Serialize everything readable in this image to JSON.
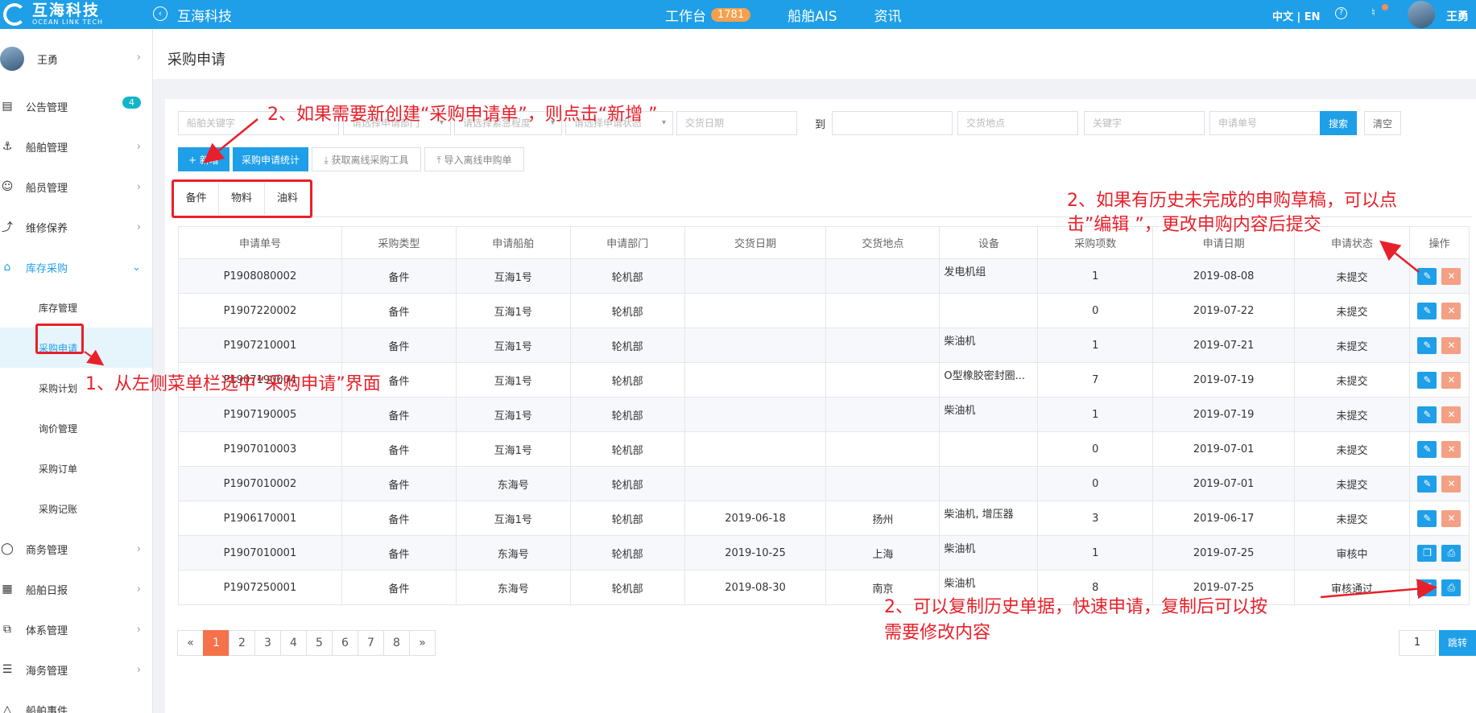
{
  "header": {
    "logo_cn": "互海科技",
    "logo_en": "OCEAN LINK TECH",
    "company": "互海科技",
    "nav": [
      {
        "label": "工作台",
        "badge": "1781"
      },
      {
        "label": "船舶AIS",
        "badge": null
      },
      {
        "label": "资讯",
        "badge": null
      }
    ],
    "lang": "中文 | EN",
    "user": "王勇"
  },
  "sidebar": {
    "user": "王勇",
    "menu": [
      {
        "label": "公告管理",
        "icon": "notice-icon",
        "badge": "4"
      },
      {
        "label": "船舶管理",
        "icon": "anchor-icon"
      },
      {
        "label": "船员管理",
        "icon": "crew-icon"
      },
      {
        "label": "维修保养",
        "icon": "wrench-icon"
      },
      {
        "label": "库存采购",
        "icon": "shop-icon",
        "active": true
      }
    ],
    "submenu": [
      "库存管理",
      "采购申请",
      "采购计划",
      "询价管理",
      "采购订单",
      "采购记账"
    ],
    "menu2": [
      {
        "label": "商务管理",
        "icon": "globe-icon"
      },
      {
        "label": "船舶日报",
        "icon": "calendar-icon"
      },
      {
        "label": "体系管理",
        "icon": "document-icon"
      },
      {
        "label": "海务管理",
        "icon": "sign-icon"
      },
      {
        "label": "船舶事件",
        "icon": "warning-icon"
      }
    ]
  },
  "page": {
    "title": "采购申请"
  },
  "filters": {
    "ship_keyword": "船舶关键字",
    "dept": "请选择申请部门",
    "urgency": "请选择紧急程度",
    "status": "请选择申请状态",
    "date_from": "交货日期",
    "to": "到",
    "date_to": "",
    "place": "交货地点",
    "keyword": "关键字",
    "order_no": "申请单号",
    "search": "搜索",
    "clear": "清空"
  },
  "toolbar": {
    "add": "新增",
    "stats": "采购申请统计",
    "offline_tool": "获取离线采购工具",
    "import": "导入离线申购单"
  },
  "tabs": [
    "备件",
    "物料",
    "油料"
  ],
  "table": {
    "headers": [
      "申请单号",
      "采购类型",
      "申请船舶",
      "申请部门",
      "交货日期",
      "交货地点",
      "设备",
      "采购项数",
      "申请日期",
      "申请状态",
      "操作"
    ],
    "rows": [
      {
        "no": "P1908080002",
        "type": "备件",
        "ship": "互海1号",
        "dept": "轮机部",
        "delivery": "",
        "place": "",
        "device": "发电机组",
        "count": "1",
        "date": "2019-08-08",
        "status": "未提交",
        "ops": "edit"
      },
      {
        "no": "P1907220002",
        "type": "备件",
        "ship": "互海1号",
        "dept": "轮机部",
        "delivery": "",
        "place": "",
        "device": "",
        "count": "0",
        "date": "2019-07-22",
        "status": "未提交",
        "ops": "edit"
      },
      {
        "no": "P1907210001",
        "type": "备件",
        "ship": "互海1号",
        "dept": "轮机部",
        "delivery": "",
        "place": "",
        "device": "柴油机",
        "count": "1",
        "date": "2019-07-21",
        "status": "未提交",
        "ops": "edit"
      },
      {
        "no": "P1907190004",
        "type": "备件",
        "ship": "互海1号",
        "dept": "轮机部",
        "delivery": "",
        "place": "",
        "device": "O型橡胶密封圈...",
        "count": "7",
        "date": "2019-07-19",
        "status": "未提交",
        "ops": "edit"
      },
      {
        "no": "P1907190005",
        "type": "备件",
        "ship": "互海1号",
        "dept": "轮机部",
        "delivery": "",
        "place": "",
        "device": "柴油机",
        "count": "1",
        "date": "2019-07-19",
        "status": "未提交",
        "ops": "edit"
      },
      {
        "no": "P1907010003",
        "type": "备件",
        "ship": "互海1号",
        "dept": "轮机部",
        "delivery": "",
        "place": "",
        "device": "",
        "count": "0",
        "date": "2019-07-01",
        "status": "未提交",
        "ops": "edit"
      },
      {
        "no": "P1907010002",
        "type": "备件",
        "ship": "东海号",
        "dept": "轮机部",
        "delivery": "",
        "place": "",
        "device": "",
        "count": "0",
        "date": "2019-07-01",
        "status": "未提交",
        "ops": "edit"
      },
      {
        "no": "P1906170001",
        "type": "备件",
        "ship": "互海1号",
        "dept": "轮机部",
        "delivery": "2019-06-18",
        "place": "扬州",
        "device": "柴油机, 增压器",
        "count": "3",
        "date": "2019-06-17",
        "status": "未提交",
        "ops": "edit"
      },
      {
        "no": "P1907010001",
        "type": "备件",
        "ship": "东海号",
        "dept": "轮机部",
        "delivery": "2019-10-25",
        "place": "上海",
        "device": "柴油机",
        "count": "1",
        "date": "2019-07-25",
        "status": "审核中",
        "ops": "copy"
      },
      {
        "no": "P1907250001",
        "type": "备件",
        "ship": "东海号",
        "dept": "轮机部",
        "delivery": "2019-08-30",
        "place": "南京",
        "device": "柴油机",
        "count": "8",
        "date": "2019-07-25",
        "status": "审核通过",
        "ops": "copy"
      }
    ]
  },
  "pager": {
    "prev": "«",
    "pages": [
      "1",
      "2",
      "3",
      "4",
      "5",
      "6",
      "7",
      "8"
    ],
    "next": "»",
    "jump_value": "1",
    "jump": "跳转"
  },
  "annotations": {
    "a1": "1、从左侧菜单栏选中“采购申请”界面",
    "a2": "2、如果需要新创建“采购申请单”，则点击“新增 ”",
    "a3_line1": "2、如果有历史未完成的申购草稿，可以点",
    "a3_line2": "击”编辑 ”，更改申购内容后提交",
    "a4_line1": "2、可以复制历史单据，快速申请，复制后可以按",
    "a4_line2": "需要修改内容"
  }
}
